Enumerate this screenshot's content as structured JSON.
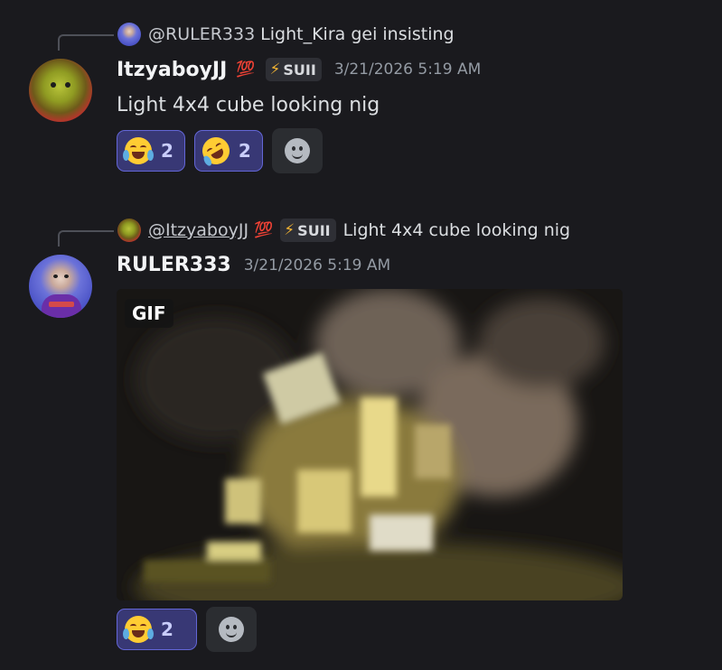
{
  "messages": [
    {
      "reply": {
        "name": "@RULER333",
        "text": "Light_Kira gei insisting"
      },
      "author": "ItzyaboyJJ",
      "badge_emoji": "💯",
      "tag": {
        "icon": "lightning-bolt-icon",
        "text": "SUII"
      },
      "timestamp": "3/21/2026 5:19 AM",
      "content": "Light 4x4 cube looking nig",
      "reactions": [
        {
          "emoji": "joy",
          "count": "2"
        },
        {
          "emoji": "rofl",
          "count": "2"
        }
      ]
    },
    {
      "reply": {
        "name": "@ItzyaboyJJ",
        "badge_emoji": "💯",
        "tag": {
          "icon": "lightning-bolt-icon",
          "text": "SUII"
        },
        "text": "Light 4x4 cube looking nig"
      },
      "author": "RULER333",
      "timestamp": "3/21/2026 5:19 AM",
      "gif": {
        "badge": "GIF"
      },
      "reactions": [
        {
          "emoji": "joy",
          "count": "2"
        }
      ]
    }
  ],
  "colors": {
    "background": "#1a1a1e",
    "reaction_active_bg": "#383875",
    "reaction_active_border": "#6366d6",
    "tag_bolt": "#f0b232"
  }
}
